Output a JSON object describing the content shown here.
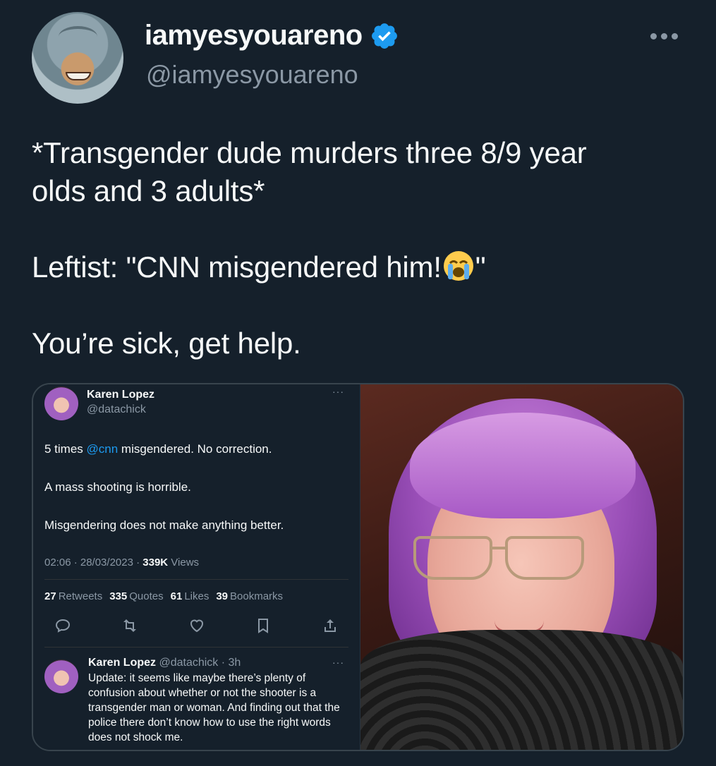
{
  "author": {
    "display_name": "iamyesyouareno",
    "handle": "@iamyesyouareno",
    "verified": true
  },
  "tweet": {
    "line1": "*Transgender dude murders three 8/9 year",
    "line2": "olds and 3 adults*",
    "line3_before_emoji": "Leftist: \"CNN misgendered him!",
    "line3_after_emoji": "\"",
    "line4": "You’re sick, get help."
  },
  "embedded": {
    "name": "Karen Lopez",
    "handle": "@datachick",
    "text_prefix": "5 times ",
    "mention": "@cnn",
    "text_suffix": " misgendered.  No correction.",
    "line2": "A mass shooting is horrible.",
    "line3": "Misgendering does not make anything better.",
    "meta_time": "02:06 · 28/03/2023 · ",
    "meta_views_count": "339K",
    "meta_views_label": " Views",
    "stats": [
      {
        "count": "27",
        "label": "Retweets"
      },
      {
        "count": "335",
        "label": "Quotes"
      },
      {
        "count": "61",
        "label": "Likes"
      },
      {
        "count": "39",
        "label": "Bookmarks"
      }
    ],
    "reply": {
      "name": "Karen Lopez",
      "handle_time": "@datachick · 3h",
      "text": "Update: it seems like maybe there’s plenty of confusion about whether or not the shooter is a transgender man or woman.  And finding out that the police there don’t know how to use the right words does not shock me."
    }
  },
  "colors": {
    "background": "#15202b",
    "text": "#f7f9f9",
    "muted": "#8b98a5",
    "accent": "#1d9bf0"
  }
}
